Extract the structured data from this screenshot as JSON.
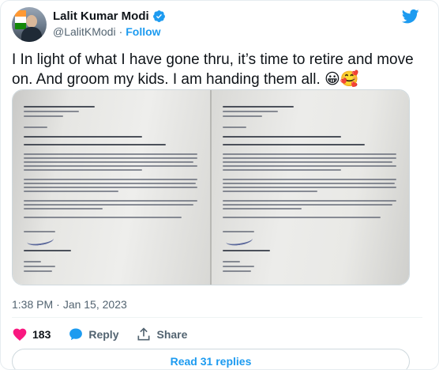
{
  "author": {
    "display_name": "Lalit Kumar Modi",
    "handle": "@LalitKModi",
    "separator": "·",
    "follow_label": "Follow",
    "verified": true
  },
  "tweet": {
    "text": "I In light of what I have gone thru, it’s time to retire and move on. And groom my kids. I am handing them all. 😀🥰",
    "time": "1:38 PM",
    "separator": "·",
    "date": "Jan 15, 2023"
  },
  "media": {
    "images": [
      {
        "description_icon": "document-photo"
      },
      {
        "description_icon": "document-photo"
      }
    ]
  },
  "actions": {
    "like_count": "183",
    "reply_label": "Reply",
    "share_label": "Share"
  },
  "read_replies_label": "Read 31 replies",
  "colors": {
    "accent": "#1d9bf0",
    "like": "#f91880",
    "text": "#0f1419",
    "secondary": "#536471"
  }
}
